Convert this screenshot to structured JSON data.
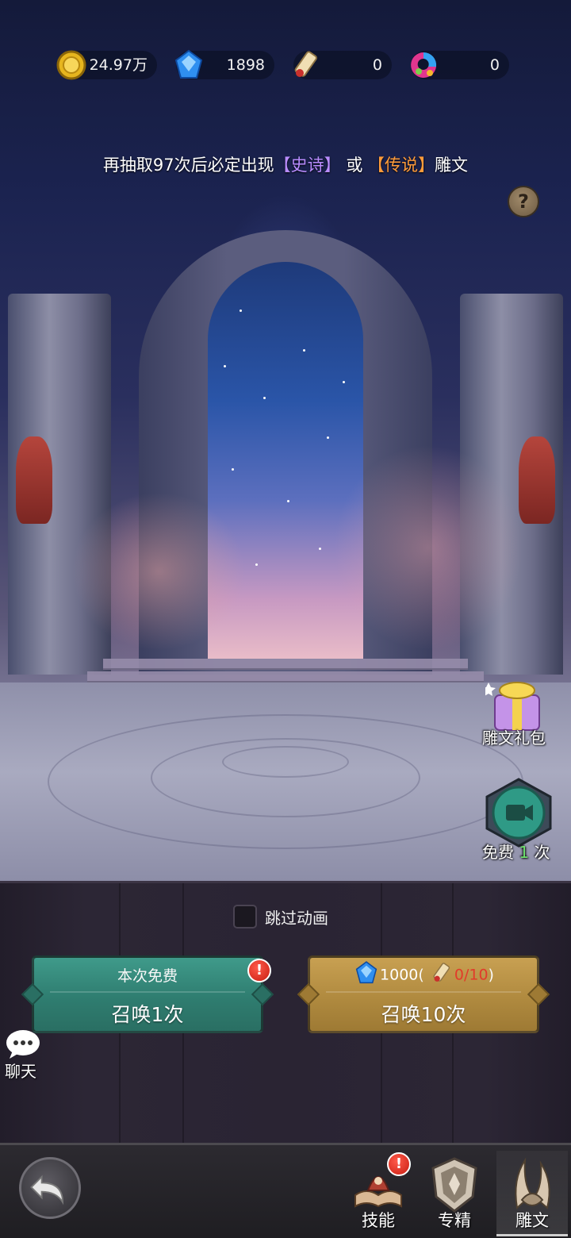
{
  "resources": [
    {
      "name": "gold",
      "icon": "gold-coin-icon",
      "value": "24.97万"
    },
    {
      "name": "diamond",
      "icon": "blue-diamond-icon",
      "value": "1898"
    },
    {
      "name": "scroll",
      "icon": "summon-scroll-icon",
      "value": "0"
    },
    {
      "name": "rainbow",
      "icon": "rainbow-gem-icon",
      "value": "0"
    }
  ],
  "notice": {
    "prefix": "再抽取97次后必定出现",
    "epic": "【史诗】",
    "middle": "或",
    "legend": "【传说】",
    "suffix": "雕文"
  },
  "help": {
    "label": "?"
  },
  "side": {
    "gift_label": "雕文礼包",
    "video_prefix": "免费",
    "video_count": "1",
    "video_suffix": "次"
  },
  "skip_animation": {
    "label": "跳过动画",
    "checked": false
  },
  "summon_one": {
    "top_label": "本次免费",
    "label": "召唤1次",
    "alert": "!"
  },
  "summon_ten": {
    "cost": "1000",
    "open_paren": "(",
    "progress": "0/10",
    "close_paren": ")",
    "label": "召唤10次"
  },
  "chat": {
    "label": "聊天"
  },
  "nav": {
    "tabs": [
      {
        "label": "技能",
        "icon": "skill-book-icon",
        "alert": "!"
      },
      {
        "label": "专精",
        "icon": "mastery-shield-icon"
      },
      {
        "label": "雕文",
        "icon": "glyph-horn-icon",
        "active": true
      }
    ]
  },
  "colors": {
    "epic": "#b98cff",
    "legend": "#ff9b3a",
    "teal_button": "#2f7d70",
    "gold_button": "#b08a3f",
    "progress_red": "#e23b2a",
    "free_green": "#6ee06e"
  }
}
